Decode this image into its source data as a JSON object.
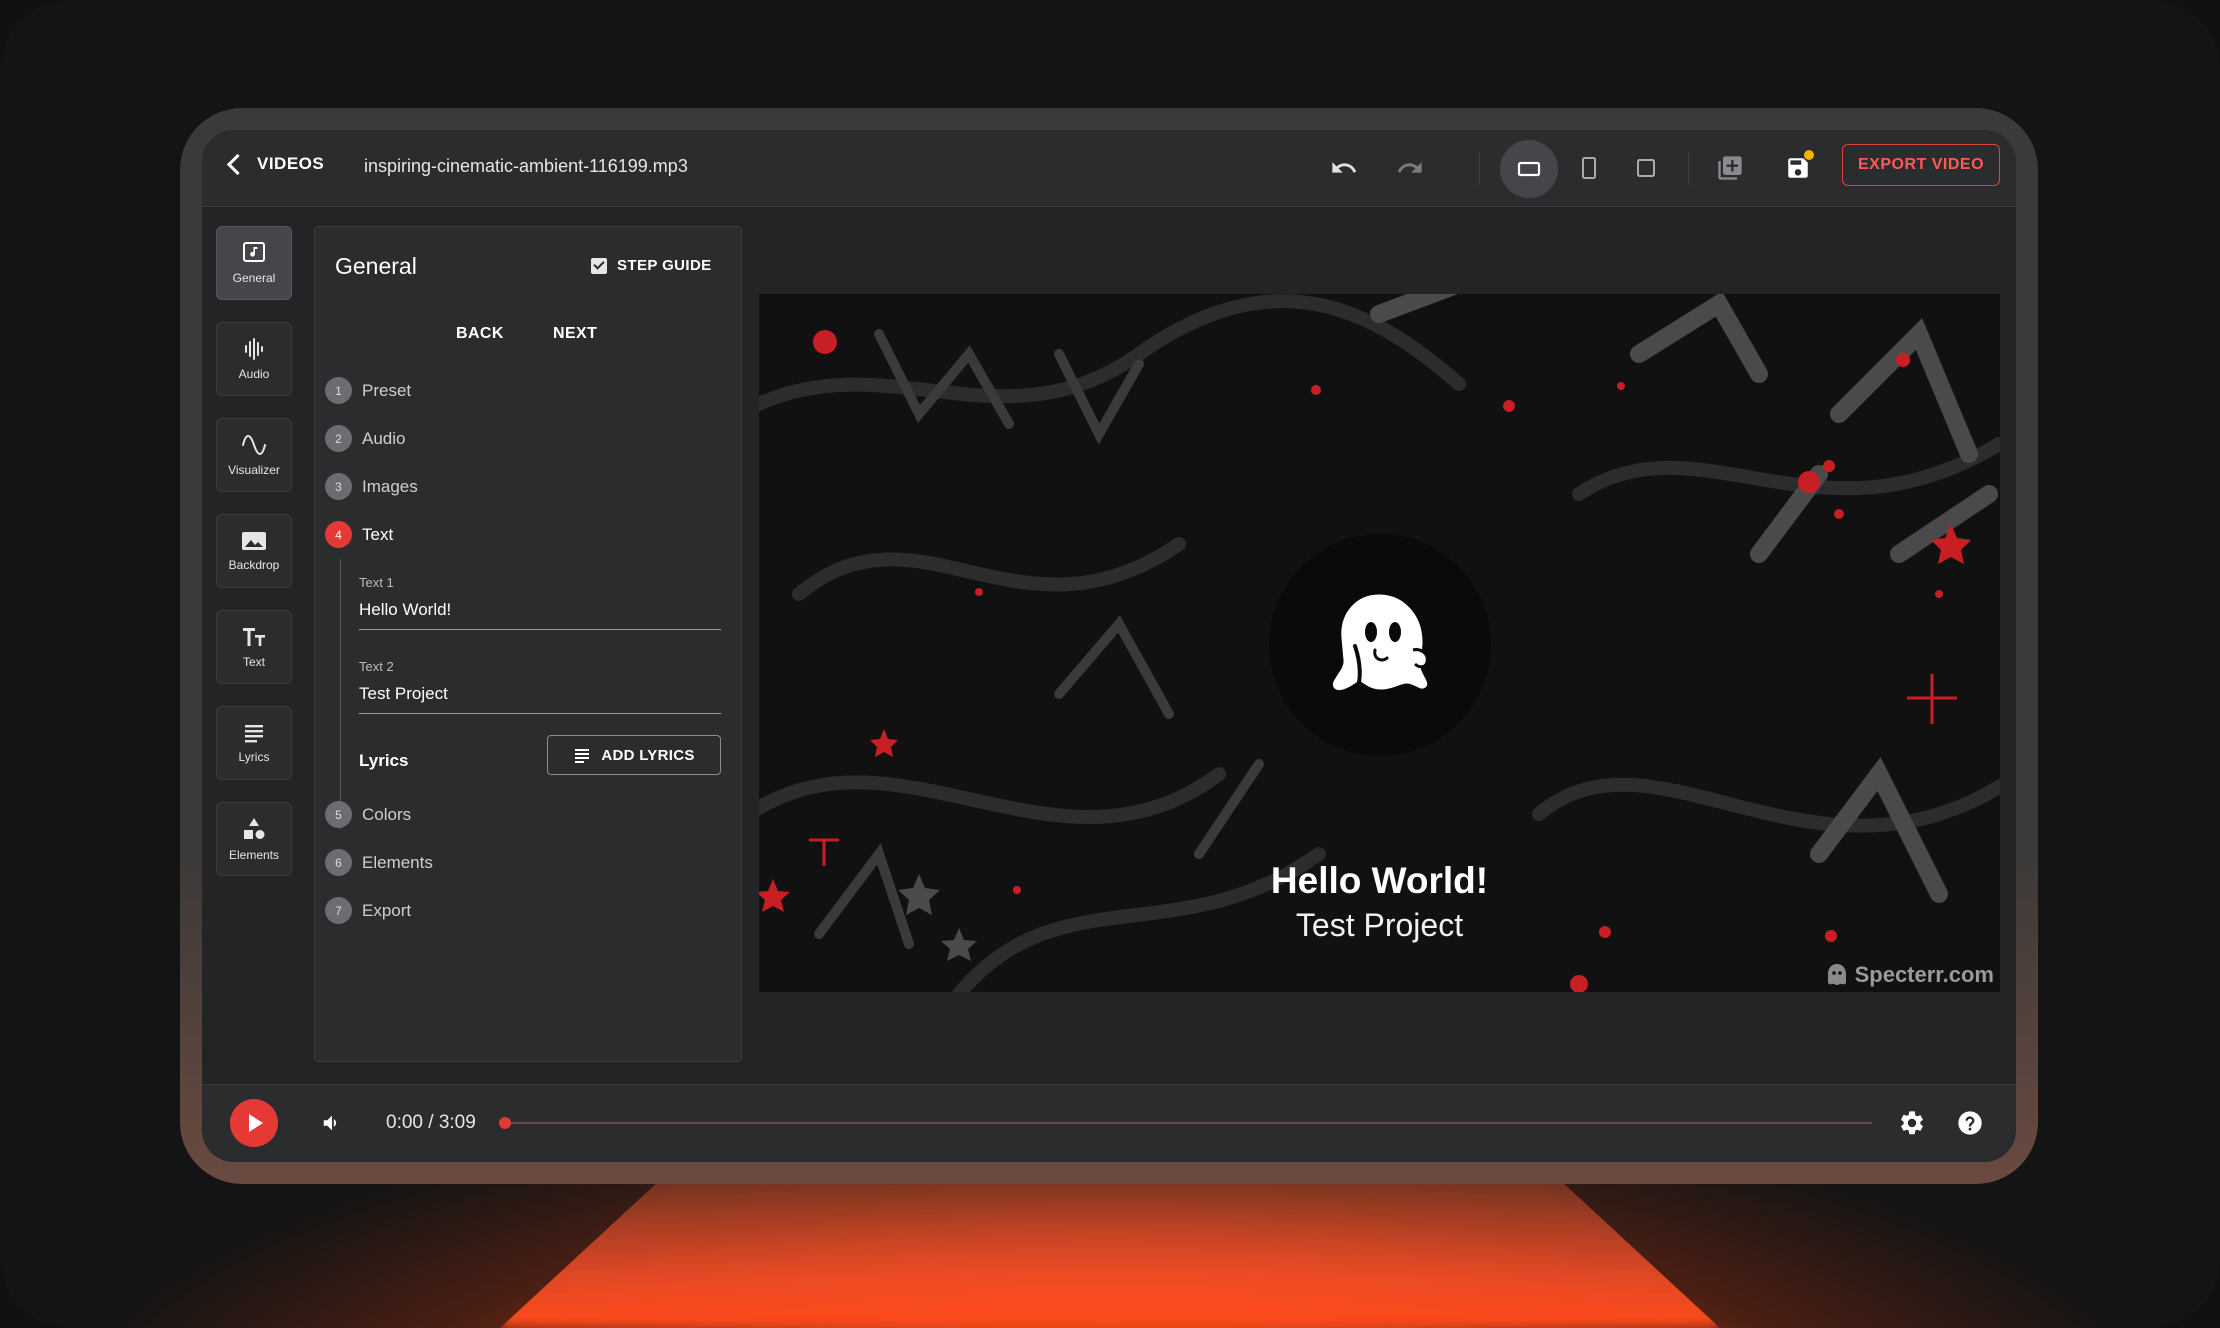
{
  "topbar": {
    "back_label": "VIDEOS",
    "file_name": "inspiring-cinematic-ambient-116199.mp3",
    "export_label": "EXPORT VIDEO"
  },
  "tools": [
    {
      "label": "General",
      "icon": "music-note-icon",
      "active": true
    },
    {
      "label": "Audio",
      "icon": "waveform-icon"
    },
    {
      "label": "Visualizer",
      "icon": "wave-icon"
    },
    {
      "label": "Backdrop",
      "icon": "image-icon"
    },
    {
      "label": "Text",
      "icon": "text-size-icon"
    },
    {
      "label": "Lyrics",
      "icon": "lines-icon"
    },
    {
      "label": "Elements",
      "icon": "shapes-icon"
    }
  ],
  "panel": {
    "title": "General",
    "step_guide_label": "STEP GUIDE",
    "step_guide_checked": true,
    "back_label": "BACK",
    "next_label": "NEXT",
    "steps": [
      {
        "num": "1",
        "label": "Preset"
      },
      {
        "num": "2",
        "label": "Audio"
      },
      {
        "num": "3",
        "label": "Images"
      },
      {
        "num": "4",
        "label": "Text",
        "active": true
      },
      {
        "num": "5",
        "label": "Colors"
      },
      {
        "num": "6",
        "label": "Elements"
      },
      {
        "num": "7",
        "label": "Export"
      }
    ],
    "text1_label": "Text 1",
    "text1_value": "Hello World!",
    "text2_label": "Text 2",
    "text2_value": "Test Project",
    "lyrics_label": "Lyrics",
    "add_lyrics_label": "ADD LYRICS"
  },
  "preview": {
    "title": "Hello World!",
    "subtitle": "Test Project",
    "watermark": "Specterr.com"
  },
  "player": {
    "time": "0:00 / 3:09",
    "progress": 0
  },
  "colors": {
    "accent": "#e53935",
    "panel_bg": "#2b2c2e",
    "export_border": "#e0413c",
    "save_badge": "#f5b400"
  }
}
